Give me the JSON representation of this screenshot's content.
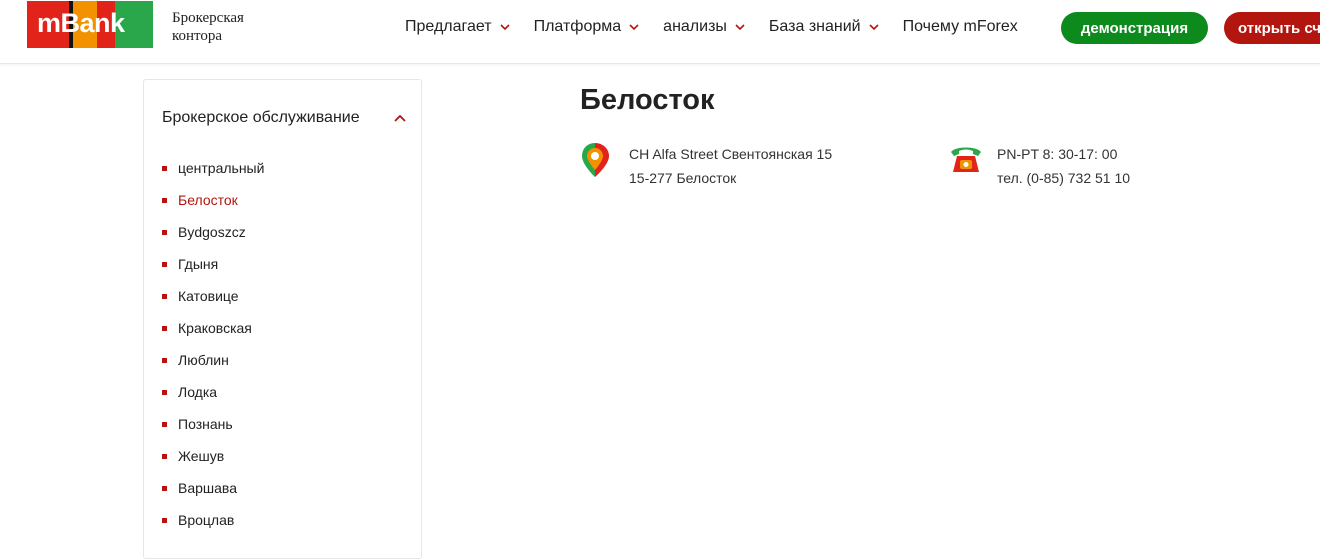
{
  "header": {
    "logo_text": "mBank",
    "brand_subtitle_line1": "Брокерская",
    "brand_subtitle_line2": "контора",
    "nav": [
      {
        "label": "Предлагает",
        "has_dropdown": true
      },
      {
        "label": "Платформа",
        "has_dropdown": true
      },
      {
        "label": "анализы",
        "has_dropdown": true
      },
      {
        "label": "База знаний",
        "has_dropdown": true
      },
      {
        "label": "Почему mForex",
        "has_dropdown": false
      }
    ],
    "demo_button": "демонстрация",
    "open_button": "открыть сч"
  },
  "sidebar": {
    "heading": "Брокерское обслуживание",
    "items": [
      {
        "label": "центральный"
      },
      {
        "label": "Белосток",
        "active": true
      },
      {
        "label": "Bydgoszcz"
      },
      {
        "label": "Гдыня"
      },
      {
        "label": "Катовице"
      },
      {
        "label": "Краковская"
      },
      {
        "label": "Люблин"
      },
      {
        "label": "Лодка"
      },
      {
        "label": "Познань"
      },
      {
        "label": "Жешув"
      },
      {
        "label": "Варшава"
      },
      {
        "label": "Вроцлав"
      }
    ]
  },
  "main": {
    "title": "Белосток",
    "address_line1": "CH Alfa Street Свентоянская 15",
    "address_line2": "15-277 Белосток",
    "hours": "PN-PT 8: 30-17: 00",
    "phone": "тел. (0-85) 732 51 10"
  },
  "icons": {
    "location": "map-pin-icon",
    "phone": "phone-icon",
    "chevron_down": "chevron-down-icon",
    "chevron_up": "chevron-up-icon"
  },
  "colors": {
    "accent_red": "#b3160f",
    "demo_green": "#0d8a1c",
    "logo_red": "#e2231a",
    "logo_orange": "#f39200",
    "logo_green": "#2aa74a"
  }
}
